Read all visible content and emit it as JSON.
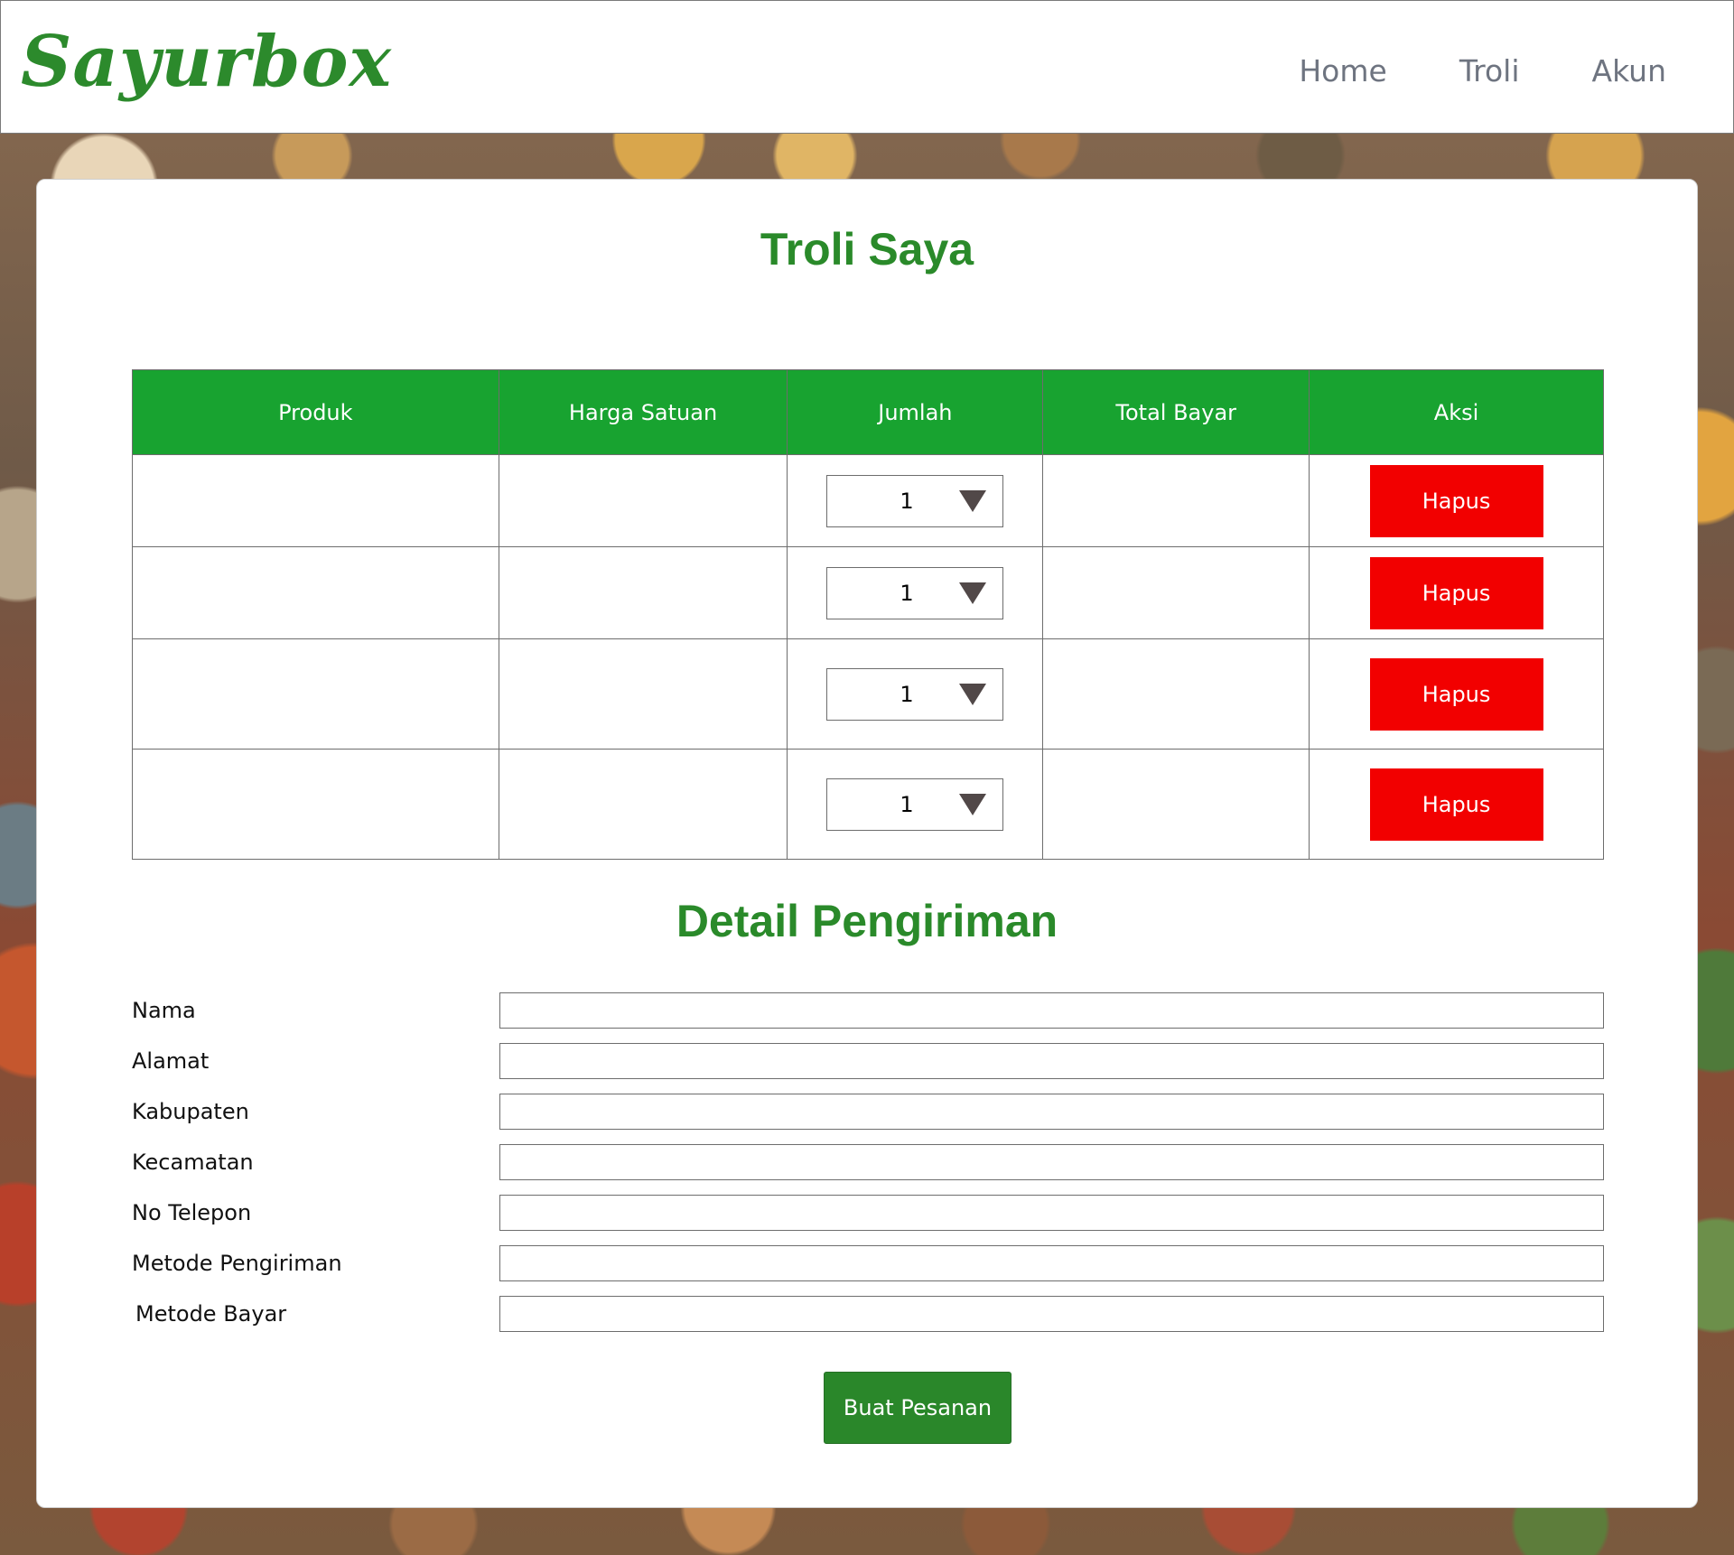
{
  "header": {
    "logo": "Sayurbox",
    "nav": [
      {
        "label": "Home"
      },
      {
        "label": "Troli"
      },
      {
        "label": "Akun"
      }
    ]
  },
  "cart": {
    "title": "Troli Saya",
    "columns": [
      "Produk",
      "Harga Satuan",
      "Jumlah",
      "Total Bayar",
      "Aksi"
    ],
    "rows": [
      {
        "product": "",
        "unit_price": "",
        "qty": "1",
        "total": "",
        "action": "Hapus"
      },
      {
        "product": "",
        "unit_price": "",
        "qty": "1",
        "total": "",
        "action": "Hapus"
      },
      {
        "product": "",
        "unit_price": "",
        "qty": "1",
        "total": "",
        "action": "Hapus"
      },
      {
        "product": "",
        "unit_price": "",
        "qty": "1",
        "total": "",
        "action": "Hapus"
      }
    ]
  },
  "shipping": {
    "title": "Detail Pengiriman",
    "fields": [
      {
        "label": "Nama",
        "value": ""
      },
      {
        "label": "Alamat",
        "value": ""
      },
      {
        "label": "Kabupaten",
        "value": ""
      },
      {
        "label": "Kecamatan",
        "value": ""
      },
      {
        "label": "No Telepon",
        "value": ""
      },
      {
        "label": "Metode Pengiriman",
        "value": ""
      },
      {
        "label": "Metode Bayar",
        "value": ""
      }
    ],
    "submit_label": "Buat Pesanan"
  },
  "colors": {
    "brand_green": "#2c8a2c",
    "header_green": "#18a330",
    "delete_red": "#f20000"
  }
}
